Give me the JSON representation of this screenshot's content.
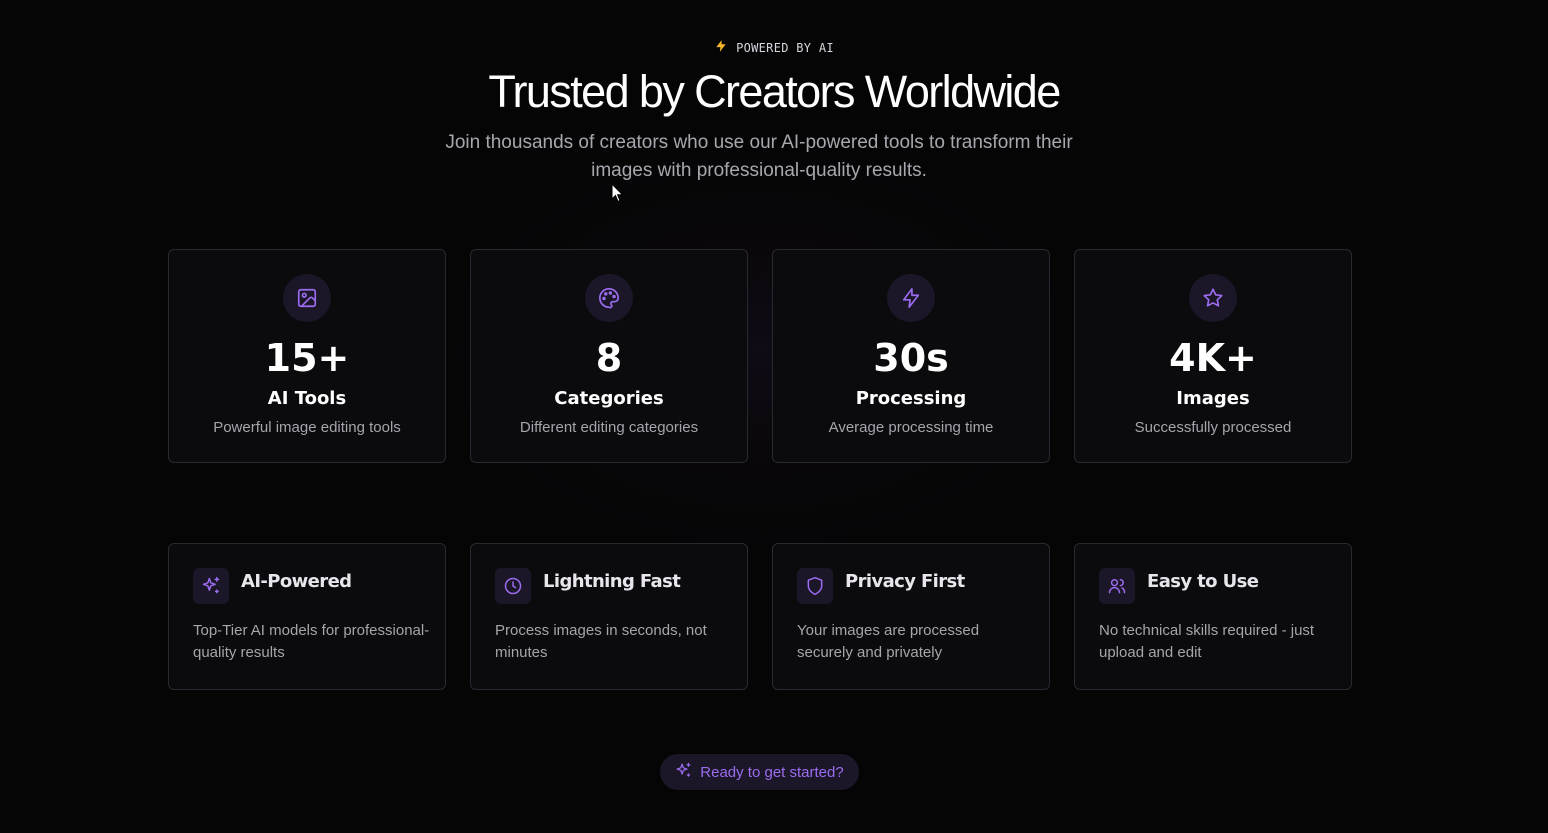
{
  "header": {
    "eyebrow": "POWERED BY AI",
    "eyebrow_icon": "lightning-icon",
    "title": "Trusted by Creators Worldwide",
    "subtitle": "Join thousands of creators who use our AI-powered tools to transform their images with professional-quality results."
  },
  "stats": [
    {
      "icon": "image-icon",
      "value": "15+",
      "label": "AI Tools",
      "desc": "Powerful image editing tools"
    },
    {
      "icon": "palette-icon",
      "value": "8",
      "label": "Categories",
      "desc": "Different editing categories"
    },
    {
      "icon": "lightning-icon",
      "value": "30s",
      "label": "Processing",
      "desc": "Average processing time"
    },
    {
      "icon": "star-icon",
      "value": "4K+",
      "label": "Images",
      "desc": "Successfully processed"
    }
  ],
  "features": [
    {
      "icon": "sparkles-icon",
      "title": "AI-Powered",
      "desc": "Top-Tier AI models for professional-quality results"
    },
    {
      "icon": "clock-icon",
      "title": "Lightning Fast",
      "desc": "Process images in seconds, not minutes"
    },
    {
      "icon": "shield-icon",
      "title": "Privacy First",
      "desc": "Your images are processed securely and privately"
    },
    {
      "icon": "users-icon",
      "title": "Easy to Use",
      "desc": "No technical skills required - just upload and edit"
    }
  ],
  "cta": {
    "label": "Ready to get started?",
    "icon": "sparkles-icon"
  },
  "colors": {
    "background": "#060506",
    "accent": "#9b6cf0",
    "icon_bg": "#1c1728",
    "card_border": "#2a2830",
    "eyebrow_bolt": "#f5b829"
  }
}
